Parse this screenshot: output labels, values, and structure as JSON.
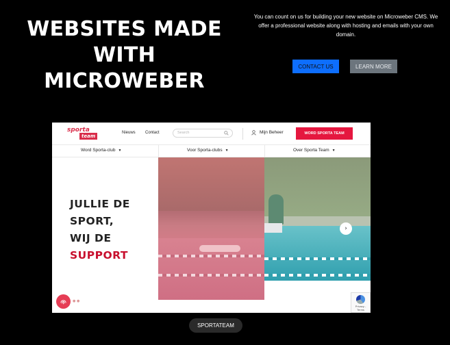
{
  "hero": {
    "title": "WEBSITES MADE WITH MICROWEBER",
    "description": "You can count on us for building your new website on Microweber CMS. We offer a professional website along with hosting and emails with your own domain.",
    "contact_label": "CONTACT US",
    "learn_label": "LEARN MORE",
    "contact_color": "#0d6efd",
    "learn_color": "#6c757d"
  },
  "preview": {
    "logo_line1": "sporta",
    "logo_line2": "team",
    "nav": [
      "Nieuws",
      "Contact"
    ],
    "search_placeholder": "Search",
    "account_label": "Mijn Beheer",
    "cta_label": "WORD SPORTA TEAM",
    "subnav": [
      "Word Sporta-club",
      "Voor Sporta-clubs",
      "Over Sporta Team"
    ],
    "headline_lines": [
      "JULLIE DE",
      "SPORT,",
      "WIJ DE"
    ],
    "headline_accent": "SUPPORT",
    "recaptcha_text": "Privacy - Terms",
    "accent_color": "#e5173f"
  },
  "tag_label": "SPORTATEAM"
}
